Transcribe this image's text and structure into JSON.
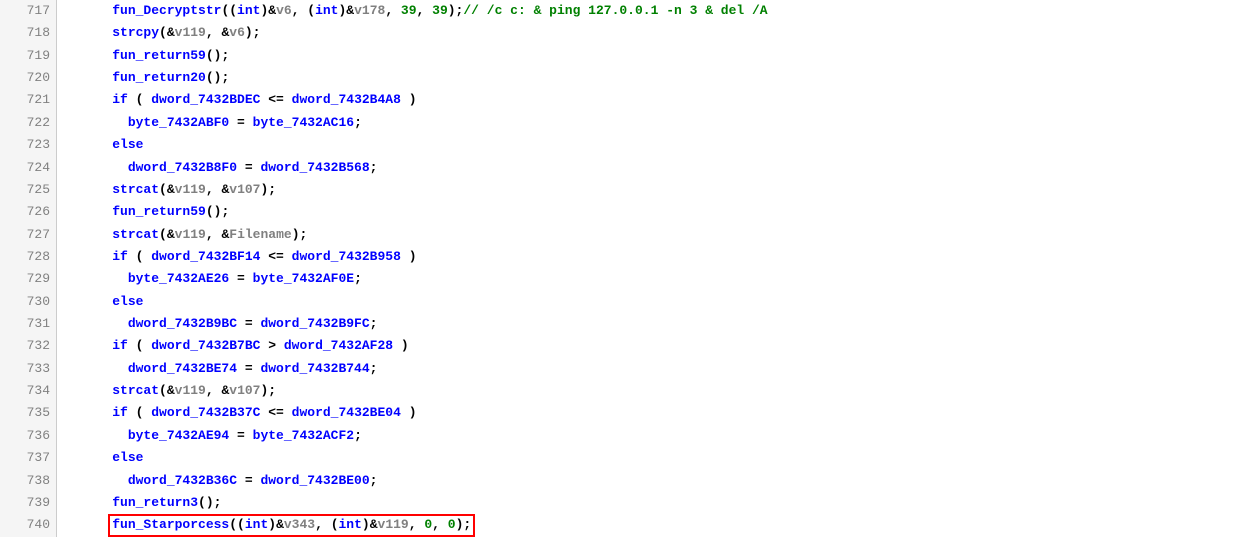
{
  "lines": [
    {
      "num": "717",
      "indent": "    ",
      "tokens": [
        {
          "c": "blue",
          "t": "fun_Decryptstr"
        },
        {
          "c": "black",
          "t": "(("
        },
        {
          "c": "blue",
          "t": "int"
        },
        {
          "c": "black",
          "t": ")&"
        },
        {
          "c": "gray",
          "t": "v6"
        },
        {
          "c": "black",
          "t": ", ("
        },
        {
          "c": "blue",
          "t": "int"
        },
        {
          "c": "black",
          "t": ")&"
        },
        {
          "c": "gray",
          "t": "v178"
        },
        {
          "c": "black",
          "t": ", "
        },
        {
          "c": "green",
          "t": "39"
        },
        {
          "c": "black",
          "t": ", "
        },
        {
          "c": "green",
          "t": "39"
        },
        {
          "c": "black",
          "t": ");"
        },
        {
          "c": "green",
          "t": "// /c c: & ping 127.0.0.1 -n 3 & del /A"
        }
      ]
    },
    {
      "num": "718",
      "indent": "    ",
      "tokens": [
        {
          "c": "blue",
          "t": "strcpy"
        },
        {
          "c": "black",
          "t": "(&"
        },
        {
          "c": "gray",
          "t": "v119"
        },
        {
          "c": "black",
          "t": ", &"
        },
        {
          "c": "gray",
          "t": "v6"
        },
        {
          "c": "black",
          "t": ");"
        }
      ]
    },
    {
      "num": "719",
      "indent": "    ",
      "tokens": [
        {
          "c": "blue",
          "t": "fun_return59"
        },
        {
          "c": "black",
          "t": "();"
        }
      ]
    },
    {
      "num": "720",
      "indent": "    ",
      "tokens": [
        {
          "c": "blue",
          "t": "fun_return20"
        },
        {
          "c": "black",
          "t": "();"
        }
      ]
    },
    {
      "num": "721",
      "indent": "    ",
      "tokens": [
        {
          "c": "blue",
          "t": "if"
        },
        {
          "c": "black",
          "t": " ( "
        },
        {
          "c": "blue",
          "t": "dword_7432BDEC"
        },
        {
          "c": "black",
          "t": " <= "
        },
        {
          "c": "blue",
          "t": "dword_7432B4A8"
        },
        {
          "c": "black",
          "t": " )"
        }
      ]
    },
    {
      "num": "722",
      "indent": "      ",
      "tokens": [
        {
          "c": "blue",
          "t": "byte_7432ABF0"
        },
        {
          "c": "black",
          "t": " = "
        },
        {
          "c": "blue",
          "t": "byte_7432AC16"
        },
        {
          "c": "black",
          "t": ";"
        }
      ]
    },
    {
      "num": "723",
      "indent": "    ",
      "tokens": [
        {
          "c": "blue",
          "t": "else"
        }
      ]
    },
    {
      "num": "724",
      "indent": "      ",
      "tokens": [
        {
          "c": "blue",
          "t": "dword_7432B8F0"
        },
        {
          "c": "black",
          "t": " = "
        },
        {
          "c": "blue",
          "t": "dword_7432B568"
        },
        {
          "c": "black",
          "t": ";"
        }
      ]
    },
    {
      "num": "725",
      "indent": "    ",
      "tokens": [
        {
          "c": "blue",
          "t": "strcat"
        },
        {
          "c": "black",
          "t": "(&"
        },
        {
          "c": "gray",
          "t": "v119"
        },
        {
          "c": "black",
          "t": ", &"
        },
        {
          "c": "gray",
          "t": "v107"
        },
        {
          "c": "black",
          "t": ");"
        }
      ]
    },
    {
      "num": "726",
      "indent": "    ",
      "tokens": [
        {
          "c": "blue",
          "t": "fun_return59"
        },
        {
          "c": "black",
          "t": "();"
        }
      ]
    },
    {
      "num": "727",
      "indent": "    ",
      "tokens": [
        {
          "c": "blue",
          "t": "strcat"
        },
        {
          "c": "black",
          "t": "(&"
        },
        {
          "c": "gray",
          "t": "v119"
        },
        {
          "c": "black",
          "t": ", &"
        },
        {
          "c": "gray",
          "t": "Filename"
        },
        {
          "c": "black",
          "t": ");"
        }
      ]
    },
    {
      "num": "728",
      "indent": "    ",
      "tokens": [
        {
          "c": "blue",
          "t": "if"
        },
        {
          "c": "black",
          "t": " ( "
        },
        {
          "c": "blue",
          "t": "dword_7432BF14"
        },
        {
          "c": "black",
          "t": " <= "
        },
        {
          "c": "blue",
          "t": "dword_7432B958"
        },
        {
          "c": "black",
          "t": " )"
        }
      ]
    },
    {
      "num": "729",
      "indent": "      ",
      "tokens": [
        {
          "c": "blue",
          "t": "byte_7432AE26"
        },
        {
          "c": "black",
          "t": " = "
        },
        {
          "c": "blue",
          "t": "byte_7432AF0E"
        },
        {
          "c": "black",
          "t": ";"
        }
      ]
    },
    {
      "num": "730",
      "indent": "    ",
      "tokens": [
        {
          "c": "blue",
          "t": "else"
        }
      ]
    },
    {
      "num": "731",
      "indent": "      ",
      "tokens": [
        {
          "c": "blue",
          "t": "dword_7432B9BC"
        },
        {
          "c": "black",
          "t": " = "
        },
        {
          "c": "blue",
          "t": "dword_7432B9FC"
        },
        {
          "c": "black",
          "t": ";"
        }
      ]
    },
    {
      "num": "732",
      "indent": "    ",
      "tokens": [
        {
          "c": "blue",
          "t": "if"
        },
        {
          "c": "black",
          "t": " ( "
        },
        {
          "c": "blue",
          "t": "dword_7432B7BC"
        },
        {
          "c": "black",
          "t": " > "
        },
        {
          "c": "blue",
          "t": "dword_7432AF28"
        },
        {
          "c": "black",
          "t": " )"
        }
      ]
    },
    {
      "num": "733",
      "indent": "      ",
      "tokens": [
        {
          "c": "blue",
          "t": "dword_7432BE74"
        },
        {
          "c": "black",
          "t": " = "
        },
        {
          "c": "blue",
          "t": "dword_7432B744"
        },
        {
          "c": "black",
          "t": ";"
        }
      ]
    },
    {
      "num": "734",
      "indent": "    ",
      "tokens": [
        {
          "c": "blue",
          "t": "strcat"
        },
        {
          "c": "black",
          "t": "(&"
        },
        {
          "c": "gray",
          "t": "v119"
        },
        {
          "c": "black",
          "t": ", &"
        },
        {
          "c": "gray",
          "t": "v107"
        },
        {
          "c": "black",
          "t": ");"
        }
      ]
    },
    {
      "num": "735",
      "indent": "    ",
      "tokens": [
        {
          "c": "blue",
          "t": "if"
        },
        {
          "c": "black",
          "t": " ( "
        },
        {
          "c": "blue",
          "t": "dword_7432B37C"
        },
        {
          "c": "black",
          "t": " <= "
        },
        {
          "c": "blue",
          "t": "dword_7432BE04"
        },
        {
          "c": "black",
          "t": " )"
        }
      ]
    },
    {
      "num": "736",
      "indent": "      ",
      "tokens": [
        {
          "c": "blue",
          "t": "byte_7432AE94"
        },
        {
          "c": "black",
          "t": " = "
        },
        {
          "c": "blue",
          "t": "byte_7432ACF2"
        },
        {
          "c": "black",
          "t": ";"
        }
      ]
    },
    {
      "num": "737",
      "indent": "    ",
      "tokens": [
        {
          "c": "blue",
          "t": "else"
        }
      ]
    },
    {
      "num": "738",
      "indent": "      ",
      "tokens": [
        {
          "c": "blue",
          "t": "dword_7432B36C"
        },
        {
          "c": "black",
          "t": " = "
        },
        {
          "c": "blue",
          "t": "dword_7432BE00"
        },
        {
          "c": "black",
          "t": ";"
        }
      ]
    },
    {
      "num": "739",
      "indent": "    ",
      "tokens": [
        {
          "c": "blue",
          "t": "fun_return3"
        },
        {
          "c": "black",
          "t": "();"
        }
      ]
    },
    {
      "num": "740",
      "indent": "    ",
      "highlight": true,
      "tokens": [
        {
          "c": "blue",
          "t": "fun_Starporcess"
        },
        {
          "c": "black",
          "t": "(("
        },
        {
          "c": "blue",
          "t": "int"
        },
        {
          "c": "black",
          "t": ")&"
        },
        {
          "c": "gray",
          "t": "v343"
        },
        {
          "c": "black",
          "t": ", ("
        },
        {
          "c": "blue",
          "t": "int"
        },
        {
          "c": "black",
          "t": ")&"
        },
        {
          "c": "gray",
          "t": "v119"
        },
        {
          "c": "black",
          "t": ", "
        },
        {
          "c": "green",
          "t": "0"
        },
        {
          "c": "black",
          "t": ", "
        },
        {
          "c": "green",
          "t": "0"
        },
        {
          "c": "black",
          "t": ");"
        }
      ]
    }
  ]
}
